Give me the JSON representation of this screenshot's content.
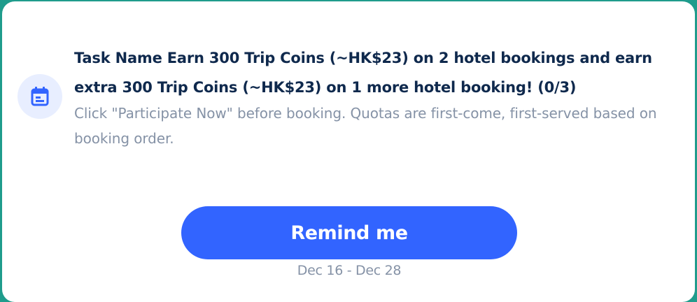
{
  "task": {
    "icon": "calendar-icon",
    "title": "Task Name Earn 300 Trip Coins (~HK$23) on 2 hotel bookings and earn extra 300 Trip Coins (~HK$23) on 1 more hotel booking! (0/3)",
    "description": "Click \"Participate Now\" before booking. Quotas are first-come, first-served based on booking order."
  },
  "action": {
    "remind_label": "Remind me"
  },
  "date_range": "Dec 16 - Dec 28",
  "colors": {
    "accent": "#3264ff",
    "title": "#0f294d",
    "secondary_text": "#8592a6",
    "icon_bg": "#e8eeff",
    "page_bg": "#1f9c8c"
  }
}
